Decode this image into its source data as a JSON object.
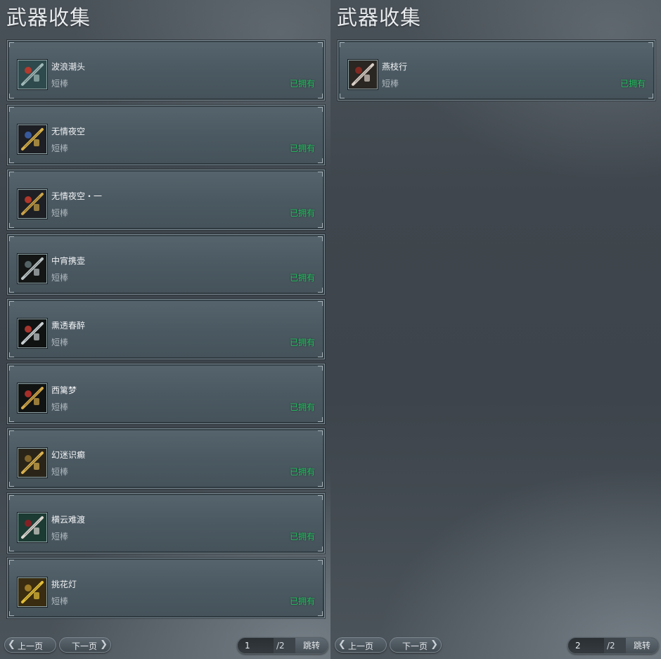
{
  "pages": [
    {
      "title": "武器收集",
      "items": [
        {
          "name": "波浪潮头",
          "type": "短棒",
          "status": "已拥有",
          "icon": "staff-icon-wave"
        },
        {
          "name": "无情夜空",
          "type": "短棒",
          "status": "已拥有",
          "icon": "staff-icon-night"
        },
        {
          "name": "无情夜空・一",
          "type": "短棒",
          "status": "已拥有",
          "icon": "staff-icon-night-red"
        },
        {
          "name": "中宵携壶",
          "type": "短棒",
          "status": "已拥有",
          "icon": "gourd-staff-icon"
        },
        {
          "name": "熏透春醉",
          "type": "短棒",
          "status": "已拥有",
          "icon": "wine-jar-icon"
        },
        {
          "name": "西篱梦",
          "type": "短棒",
          "status": "已拥有",
          "icon": "lantern-staff-icon"
        },
        {
          "name": "幻迷识癫",
          "type": "短棒",
          "status": "已拥有",
          "icon": "golden-staff-icon"
        },
        {
          "name": "横云难渡",
          "type": "短棒",
          "status": "已拥有",
          "icon": "ribbon-staff-icon"
        },
        {
          "name": "挑花灯",
          "type": "短棒",
          "status": "已拥有",
          "icon": "flower-lamp-icon"
        }
      ],
      "pagination": {
        "prev_label": "上一页",
        "next_label": "下一页",
        "current_page": "1",
        "total": "/2",
        "jump_label": "跳转"
      }
    },
    {
      "title": "武器收集",
      "items": [
        {
          "name": "燕枝行",
          "type": "短棒",
          "status": "已拥有",
          "icon": "crossed-staff-icon"
        }
      ],
      "pagination": {
        "prev_label": "上一页",
        "next_label": "下一页",
        "current_page": "2",
        "total": "/2",
        "jump_label": "跳转"
      }
    }
  ],
  "colors": {
    "owned": "#21c25e",
    "card": "#4b5962",
    "background": "#3d444b"
  }
}
